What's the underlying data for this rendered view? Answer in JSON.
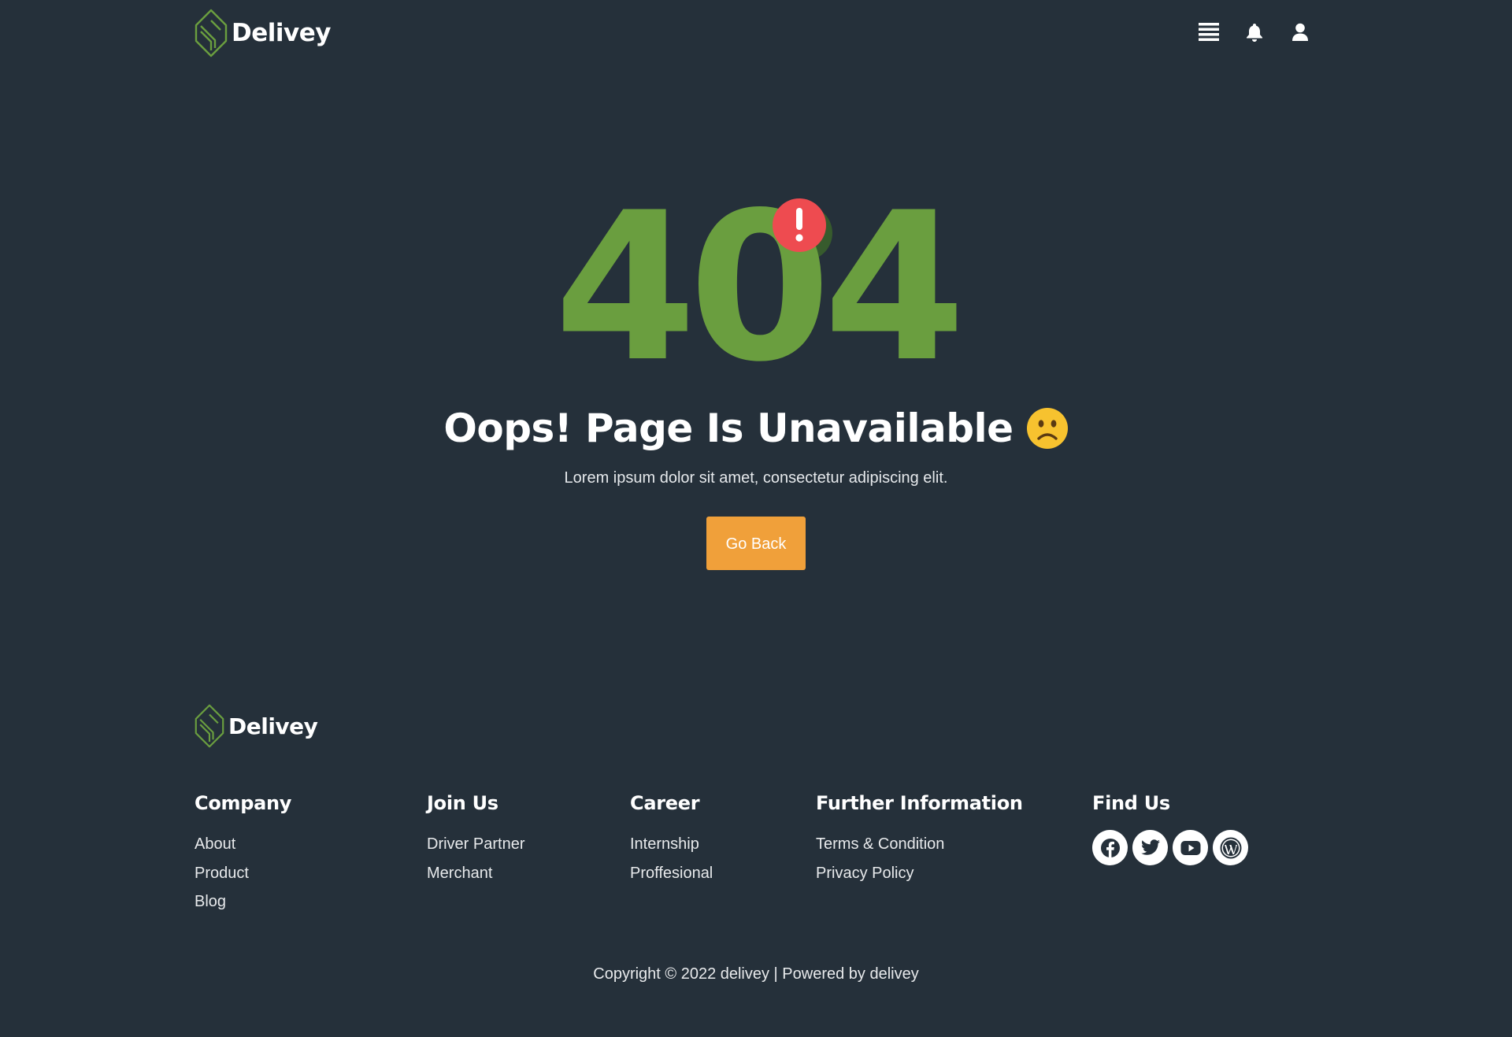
{
  "header": {
    "brand": "Delivey",
    "icons": [
      "menu-icon",
      "bell-icon",
      "user-icon"
    ]
  },
  "hero": {
    "code": "404",
    "headline": "Oops! Page Is Unavailable",
    "emoji": "🙁",
    "subtext": "Lorem ipsum dolor sit amet, consectetur adipiscing elit.",
    "button_label": "Go Back"
  },
  "footer": {
    "brand": "Delivey",
    "columns": [
      {
        "title": "Company",
        "links": [
          "About",
          "Product",
          "Blog"
        ]
      },
      {
        "title": "Join Us",
        "links": [
          "Driver Partner",
          "Merchant"
        ]
      },
      {
        "title": "Career",
        "links": [
          "Internship",
          "Proffesional"
        ]
      },
      {
        "title": "Further Information",
        "links": [
          "Terms & Condition",
          "Privacy Policy"
        ]
      }
    ],
    "find_us": {
      "title": "Find Us",
      "icons": [
        "facebook-icon",
        "twitter-icon",
        "youtube-icon",
        "wordpress-icon"
      ]
    },
    "copyright": "Copyright © 2022 delivey | Powered by delivey"
  },
  "colors": {
    "background": "#25303a",
    "brand_green": "#6a9e3f",
    "accent_orange": "#f0a03a",
    "alert_red": "#ee4b50",
    "emoji_yellow": "#f7c22f"
  }
}
